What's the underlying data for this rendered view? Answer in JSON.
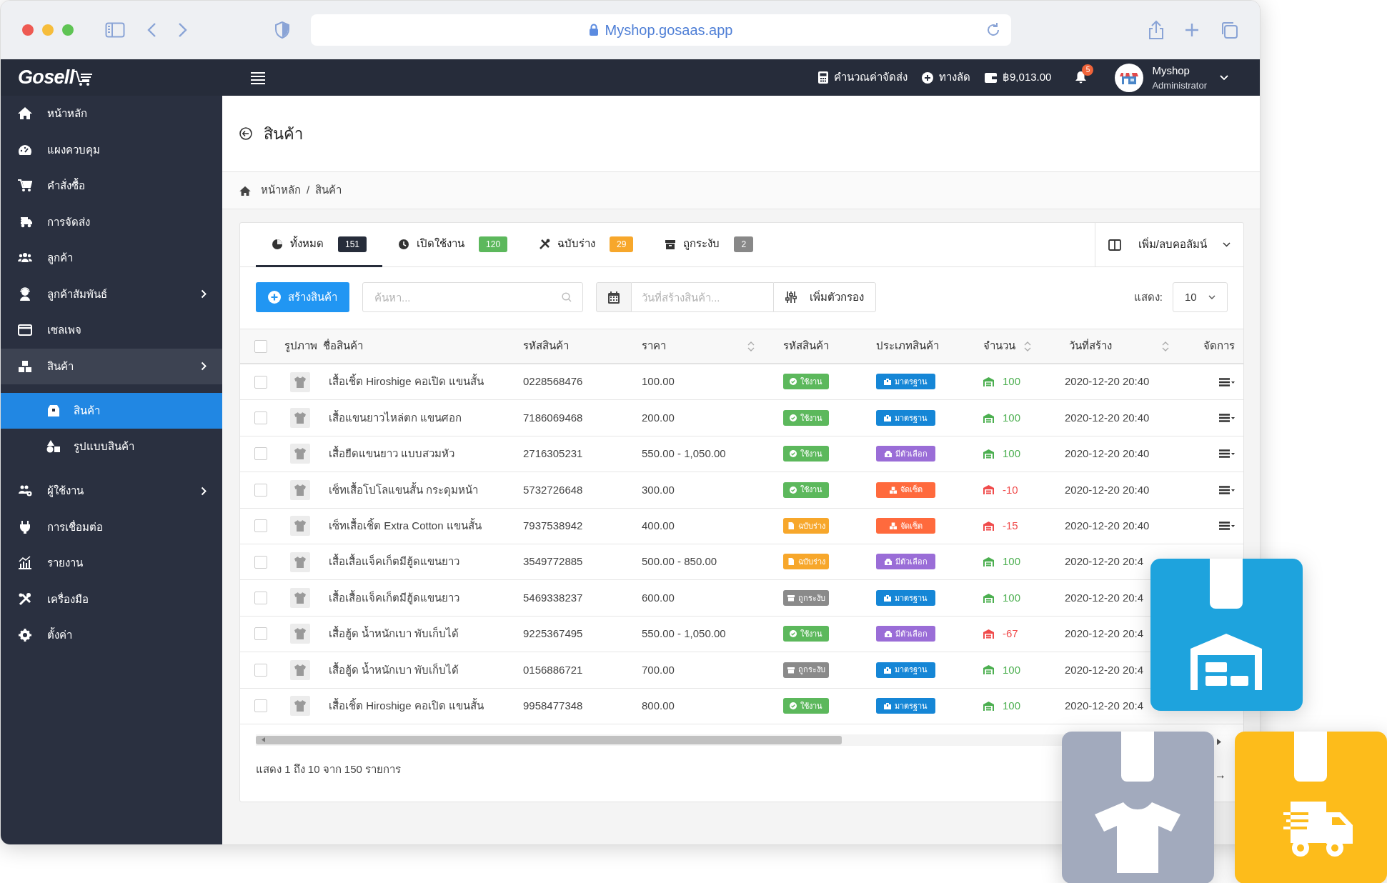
{
  "browser": {
    "url": "Myshop.gosaas.app"
  },
  "topbar": {
    "logo": "Gosell",
    "shipping_calc": "คำนวณค่าจัดส่ง",
    "shortcut": "ทางลัด",
    "balance": "฿9,013.00",
    "notification_count": "5",
    "shop_name": "Myshop",
    "role": "Administrator"
  },
  "sidebar": {
    "items": [
      {
        "label": "หน้าหลัก",
        "kind": "link"
      },
      {
        "label": "แผงควบคุม",
        "kind": "link"
      },
      {
        "label": "คำสั่งซื้อ",
        "kind": "link"
      },
      {
        "label": "การจัดส่ง",
        "kind": "link"
      },
      {
        "label": "ลูกค้า",
        "kind": "link"
      },
      {
        "label": "ลูกค้าสัมพันธ์",
        "kind": "group",
        "expanded": false
      },
      {
        "label": "เซลเพจ",
        "kind": "link"
      },
      {
        "label": "สินค้า",
        "kind": "group",
        "expanded": true,
        "children": [
          {
            "label": "สินค้า",
            "selected": true
          },
          {
            "label": "รูปแบบสินค้า",
            "selected": false
          }
        ]
      },
      {
        "label": "ผู้ใช้งาน",
        "kind": "group",
        "expanded": false
      },
      {
        "label": "การเชื่อมต่อ",
        "kind": "link"
      },
      {
        "label": "รายงาน",
        "kind": "link"
      },
      {
        "label": "เครื่องมือ",
        "kind": "link"
      },
      {
        "label": "ตั้งค่า",
        "kind": "link"
      }
    ]
  },
  "page": {
    "title": "สินค้า",
    "breadcrumb": [
      "หน้าหลัก",
      "สินค้า"
    ],
    "breadcrumb_separator": "/"
  },
  "tabs": [
    {
      "label": "ทั้งหมด",
      "count": "151",
      "color": "#262c3a",
      "selected": true
    },
    {
      "label": "เปิดใช้งาน",
      "count": "120",
      "color": "#5cb85c",
      "selected": false
    },
    {
      "label": "ฉบับร่าง",
      "count": "29",
      "color": "#f7a72b",
      "selected": false
    },
    {
      "label": "ถูกระงับ",
      "count": "2",
      "color": "#888888",
      "selected": false
    }
  ],
  "column_toggle": "เพิ่ม/ลบคอลัมน์",
  "toolbar": {
    "create_button": "สร้างสินค้า",
    "search": {
      "placeholder": "ค้นหา..."
    },
    "date_filter": {
      "placeholder": "วันที่สร้างสินค้า..."
    },
    "add_filter": "เพิ่มตัวกรอง",
    "page_size_label": "แสดง:",
    "page_size": "10"
  },
  "table": {
    "select_all_checked": false,
    "columns": [
      {
        "label": "รูปภาพ",
        "sortable": false
      },
      {
        "label": "ชื่อสินค้า",
        "sortable": false
      },
      {
        "label": "รหัสสินค้า",
        "sortable": false
      },
      {
        "label": "ราคา",
        "sortable": true
      },
      {
        "label": "รหัสสินค้า",
        "sortable": false
      },
      {
        "label": "ประเภทสินค้า",
        "sortable": false
      },
      {
        "label": "จำนวน",
        "sortable": true
      },
      {
        "label": "วันที่สร้าง",
        "sortable": true
      },
      {
        "label": "จัดการ",
        "sortable": false
      }
    ],
    "rows": [
      {
        "checked": false,
        "name": "เสื้อเชิ้ต Hiroshige คอเปิด แขนสั้น",
        "sku": "0228568476",
        "price": "100.00",
        "status": {
          "label": "ใช้งาน",
          "kind": "active"
        },
        "type": {
          "label": "มาตรฐาน",
          "kind": "standard"
        },
        "stock": {
          "value": "100",
          "negative": false
        },
        "created": "2020-12-20 20:40"
      },
      {
        "checked": false,
        "name": "เสื้อแขนยาวไหล่ตก แขนศอก",
        "sku": "7186069468",
        "price": "200.00",
        "status": {
          "label": "ใช้งาน",
          "kind": "active"
        },
        "type": {
          "label": "มาตรฐาน",
          "kind": "standard"
        },
        "stock": {
          "value": "100",
          "negative": false
        },
        "created": "2020-12-20 20:40"
      },
      {
        "checked": false,
        "name": "เสื้อยืดแขนยาว แบบสวมหัว",
        "sku": "2716305231",
        "price": "550.00 - 1,050.00",
        "status": {
          "label": "ใช้งาน",
          "kind": "active"
        },
        "type": {
          "label": "มีตัวเลือก",
          "kind": "variant"
        },
        "stock": {
          "value": "100",
          "negative": false
        },
        "created": "2020-12-20 20:40"
      },
      {
        "checked": false,
        "name": "เซ็ทเสื้อโปโลแขนสั้น กระดุมหน้า",
        "sku": "5732726648",
        "price": "300.00",
        "status": {
          "label": "ใช้งาน",
          "kind": "active"
        },
        "type": {
          "label": "จัดเซ็ต",
          "kind": "combo"
        },
        "stock": {
          "value": "-10",
          "negative": true
        },
        "created": "2020-12-20 20:40"
      },
      {
        "checked": false,
        "name": "เซ็ทเสื้อเชิ้ต Extra Cotton แขนสั้น",
        "sku": "7937538942",
        "price": "400.00",
        "status": {
          "label": "ฉบับร่าง",
          "kind": "draft"
        },
        "type": {
          "label": "จัดเซ็ต",
          "kind": "combo"
        },
        "stock": {
          "value": "-15",
          "negative": true
        },
        "created": "2020-12-20 20:40"
      },
      {
        "checked": false,
        "name": "เสื้อเสื้อแจ็คเก็ตมีฮู้ดแขนยาว",
        "sku": "3549772885",
        "price": "500.00 - 850.00",
        "status": {
          "label": "ฉบับร่าง",
          "kind": "draft"
        },
        "type": {
          "label": "มีตัวเลือก",
          "kind": "variant"
        },
        "stock": {
          "value": "100",
          "negative": false
        },
        "created": "2020-12-20 20:4"
      },
      {
        "checked": false,
        "name": "เสื้อเสื้อแจ็คเก็ตมีฮู้ดแขนยาว",
        "sku": "5469338237",
        "price": "600.00",
        "status": {
          "label": "ถูกระงับ",
          "kind": "banned"
        },
        "type": {
          "label": "มาตรฐาน",
          "kind": "standard"
        },
        "stock": {
          "value": "100",
          "negative": false
        },
        "created": "2020-12-20 20:4"
      },
      {
        "checked": false,
        "name": "เสื้อฮู้ด น้ำหนักเบา พับเก็บได้",
        "sku": "9225367495",
        "price": "550.00 - 1,050.00",
        "status": {
          "label": "ใช้งาน",
          "kind": "active"
        },
        "type": {
          "label": "มีตัวเลือก",
          "kind": "variant"
        },
        "stock": {
          "value": "-67",
          "negative": true
        },
        "created": "2020-12-20 20:4"
      },
      {
        "checked": false,
        "name": "เสื้อฮู้ด น้ำหนักเบา พับเก็บได้",
        "sku": "0156886721",
        "price": "700.00",
        "status": {
          "label": "ถูกระงับ",
          "kind": "banned"
        },
        "type": {
          "label": "มาตรฐาน",
          "kind": "standard"
        },
        "stock": {
          "value": "100",
          "negative": false
        },
        "created": "2020-12-20 20:4"
      },
      {
        "checked": false,
        "name": "เสื้อเชิ้ต Hiroshige คอเปิด แขนสั้น",
        "sku": "9958477348",
        "price": "800.00",
        "status": {
          "label": "ใช้งาน",
          "kind": "active"
        },
        "type": {
          "label": "มาตรฐาน",
          "kind": "standard"
        },
        "stock": {
          "value": "100",
          "negative": false
        },
        "created": "2020-12-20 20:4"
      }
    ]
  },
  "footer": {
    "summary": "แสดง 1 ถึง 10 จาก 150 รายการ",
    "next": "→"
  }
}
